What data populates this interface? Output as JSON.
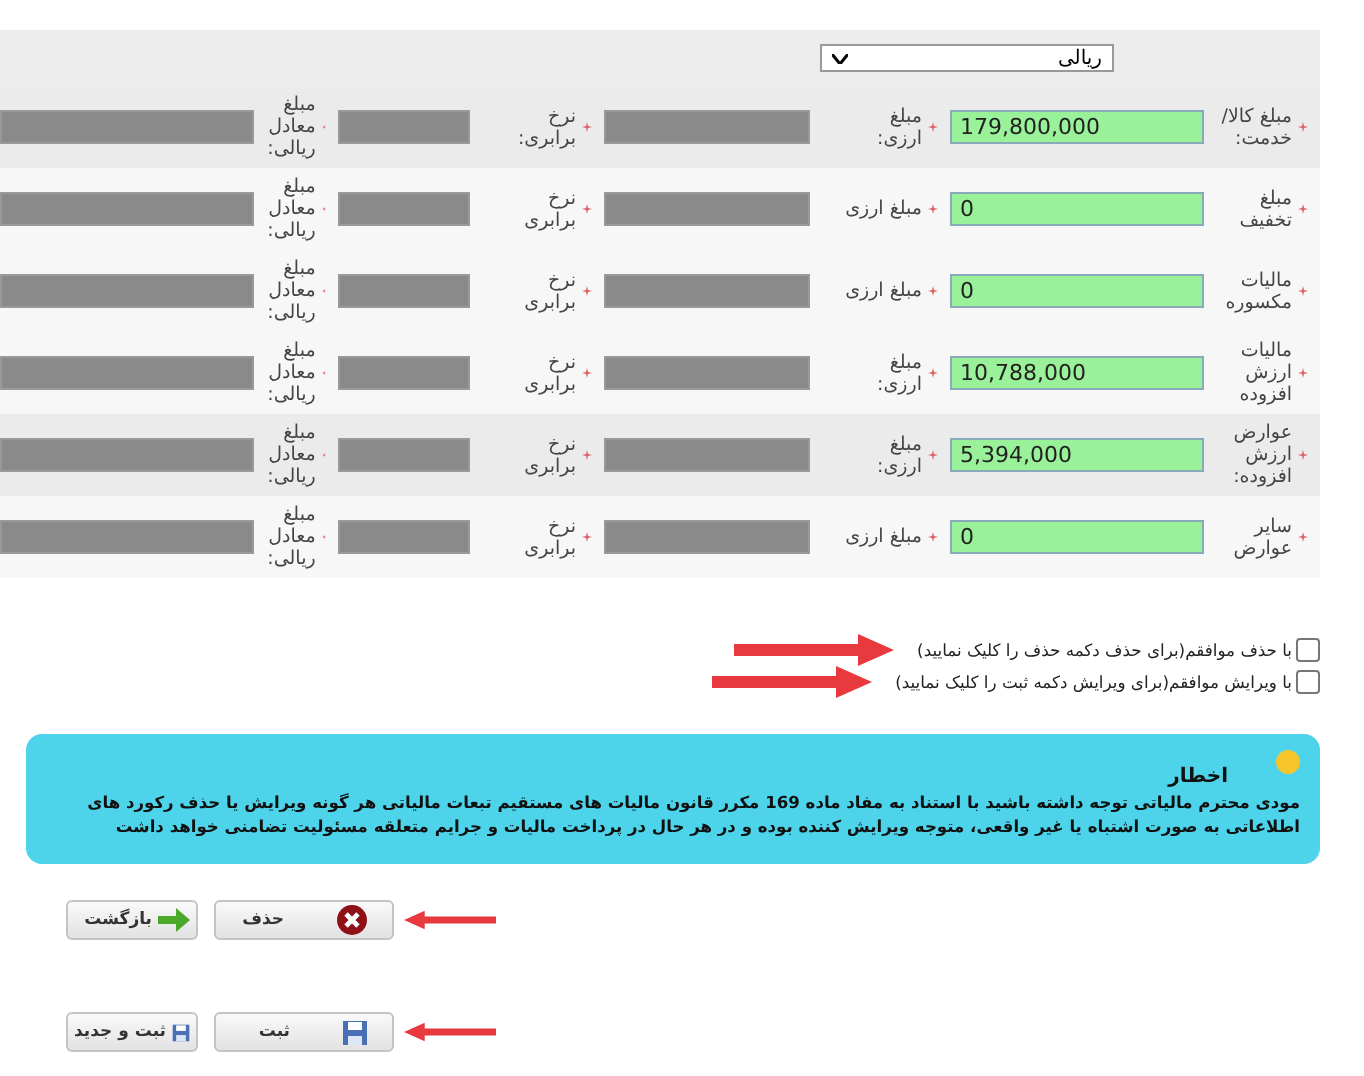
{
  "currency_select": {
    "value": "ریالی"
  },
  "rows": [
    {
      "shaded": true,
      "cells": [
        {
          "label": "مبلغ کالا/ خدمت:",
          "value": "179,800,000",
          "disabled": false
        },
        {
          "label": "مبلغ ارزی:",
          "disabled": true
        },
        {
          "label": "نرخ برابری:",
          "disabled": true
        },
        {
          "label": "مبلغ معادل ریالی:",
          "disabled": true
        }
      ]
    },
    {
      "shaded": false,
      "cells": [
        {
          "label": "مبلغ تخفیف",
          "value": "0",
          "disabled": false
        },
        {
          "label": "مبلغ ارزی",
          "disabled": true
        },
        {
          "label": "نرخ برابری",
          "disabled": true
        },
        {
          "label": "مبلغ معادل ریالی:",
          "disabled": true
        }
      ]
    },
    {
      "shaded": false,
      "cells": [
        {
          "label": "مالیات مکسوره",
          "value": "0",
          "disabled": false
        },
        {
          "label": "مبلغ ارزی",
          "disabled": true
        },
        {
          "label": "نرخ برابری",
          "disabled": true
        },
        {
          "label": "مبلغ معادل ریالی:",
          "disabled": true
        }
      ]
    },
    {
      "shaded": false,
      "cells": [
        {
          "label": "مالیات ارزش افزوده",
          "value": "10,788,000",
          "disabled": false
        },
        {
          "label": "مبلغ ارزی:",
          "disabled": true
        },
        {
          "label": "نرخ برابری",
          "disabled": true
        },
        {
          "label": "مبلغ معادل ریالی:",
          "disabled": true
        }
      ]
    },
    {
      "shaded": true,
      "cells": [
        {
          "label": "عوارض ارزش افزوده:",
          "value": "5,394,000",
          "disabled": false
        },
        {
          "label": "مبلغ ارزی:",
          "disabled": true
        },
        {
          "label": "نرخ برابری",
          "disabled": true
        },
        {
          "label": "مبلغ معادل ریالی:",
          "disabled": true
        }
      ]
    },
    {
      "shaded": false,
      "cells": [
        {
          "label": "سایر عوارض",
          "value": "0",
          "disabled": false
        },
        {
          "label": "مبلغ ارزی",
          "disabled": true
        },
        {
          "label": "نرخ برابری",
          "disabled": true
        },
        {
          "label": "مبلغ معادل ریالی:",
          "disabled": true
        }
      ]
    }
  ],
  "checkboxes": [
    {
      "label": "با حذف موافقم(برای حذف دکمه حذف را کلیک نمایید)",
      "checked": false,
      "arrow": true
    },
    {
      "label": "با ویرایش موافقم(برای ویرایش دکمه ثبت را کلیک نمایید)",
      "checked": false,
      "arrow": true
    }
  ],
  "alert": {
    "title": "اخطار",
    "message": "مودی محترم مالیاتی توجه داشته باشید با استناد به مفاد ماده 169 مکرر قانون مالیات های مستقیم تبعات مالیاتی هر گونه ویرایش یا حذف رکورد های اطلاعاتی به صورت اشتباه یا غیر واقعی، متوجه ویرایش کننده بوده و در هر حال در پرداخت مالیات و جرایم متعلقه مسئولیت تضامنی خواهد داشت"
  },
  "button_rows": [
    {
      "arrow": true,
      "buttons": [
        {
          "label": "حذف",
          "kind": "delete"
        },
        {
          "label": "بازگشت",
          "kind": "back"
        }
      ]
    },
    {
      "arrow": true,
      "buttons": [
        {
          "label": "ثبت",
          "kind": "save"
        },
        {
          "label": "ثبت و جدید",
          "kind": "save"
        }
      ]
    }
  ]
}
